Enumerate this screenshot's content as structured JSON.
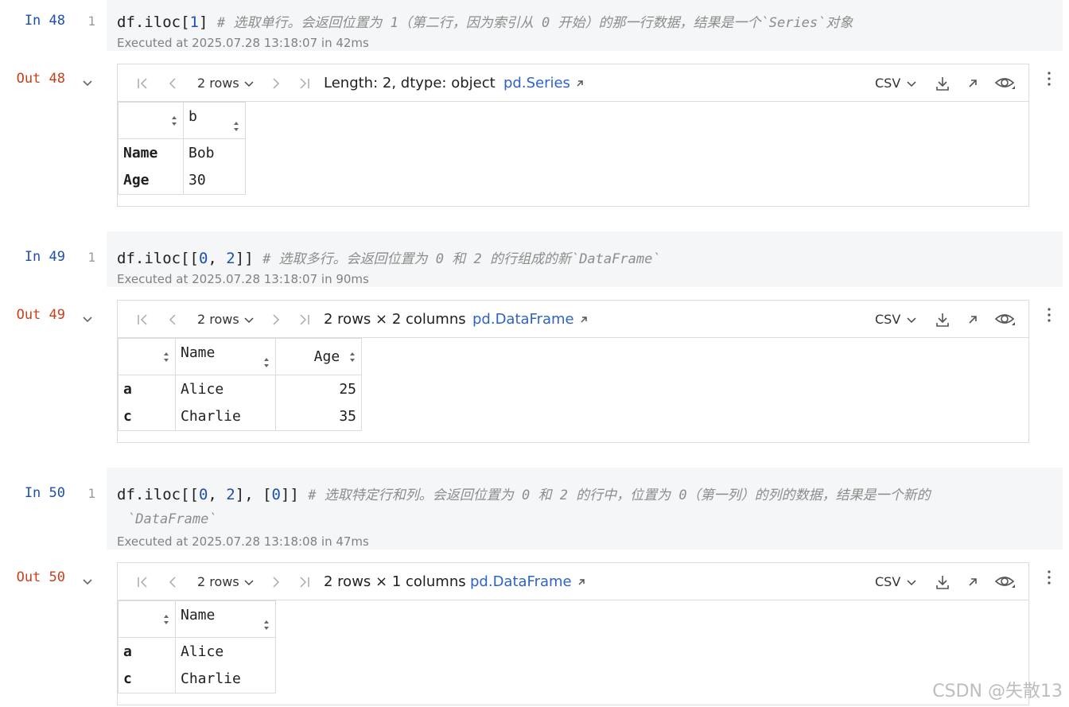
{
  "cells": [
    {
      "in_label": "In 48",
      "out_label": "Out 48",
      "line_no": "1",
      "code_prefix": "df.iloc[",
      "code_arg": "1",
      "code_suffix": "] ",
      "comment": "# 选取单行。会返回位置为 1（第二行，因为索引从 0 开始）的那一行数据，结果是一个`Series`对象",
      "comment_cont": "",
      "executed": "Executed at 2025.07.28 13:18:07 in 42ms",
      "toolbar": {
        "rows": "2 rows",
        "summary": "Length: 2, dtype: object",
        "type_link": "pd.Series",
        "csv": "CSV"
      },
      "table": {
        "headers": [
          "",
          "b"
        ],
        "rows": [
          [
            "Name",
            "Bob"
          ],
          [
            "Age",
            "30"
          ]
        ]
      }
    },
    {
      "in_label": "In 49",
      "out_label": "Out 49",
      "line_no": "1",
      "code_prefix": "df.iloc[[",
      "code_arg": "0",
      "code_mid": ", ",
      "code_arg2": "2",
      "code_suffix": "]] ",
      "comment": "# 选取多行。会返回位置为 0 和 2 的行组成的新`DataFrame`",
      "executed": "Executed at 2025.07.28 13:18:07 in 90ms",
      "toolbar": {
        "rows": "2 rows",
        "summary": "2 rows × 2 columns",
        "type_link": "pd.DataFrame",
        "csv": "CSV"
      },
      "table": {
        "headers": [
          "",
          "Name",
          "Age"
        ],
        "rows": [
          [
            "a",
            "Alice",
            "25"
          ],
          [
            "c",
            "Charlie",
            "35"
          ]
        ]
      }
    },
    {
      "in_label": "In 50",
      "out_label": "Out 50",
      "line_no": "1",
      "code_prefix": "df.iloc[[",
      "code_arg": "0",
      "code_mid": ", ",
      "code_arg2": "2",
      "code_mid2": "], [",
      "code_arg3": "0",
      "code_suffix": "]] ",
      "comment": "# 选取特定行和列。会返回位置为 0 和 2 的行中，位置为 0（第一列）的列的数据，结果是一个新的",
      "comment_cont": "`DataFrame`",
      "executed": "Executed at 2025.07.28 13:18:08 in 47ms",
      "toolbar": {
        "rows": "2 rows",
        "summary": "2 rows × 1 columns",
        "type_link": "pd.DataFrame",
        "csv": "CSV"
      },
      "table": {
        "headers": [
          "",
          "Name"
        ],
        "rows": [
          [
            "a",
            "Alice"
          ],
          [
            "c",
            "Charlie"
          ]
        ]
      }
    }
  ],
  "watermark": "CSDN @失散13",
  "colors": {
    "in": "#1f4fb0",
    "out": "#c8401c",
    "link": "#2f62c9",
    "cell_bg": "#f5f6f7"
  }
}
